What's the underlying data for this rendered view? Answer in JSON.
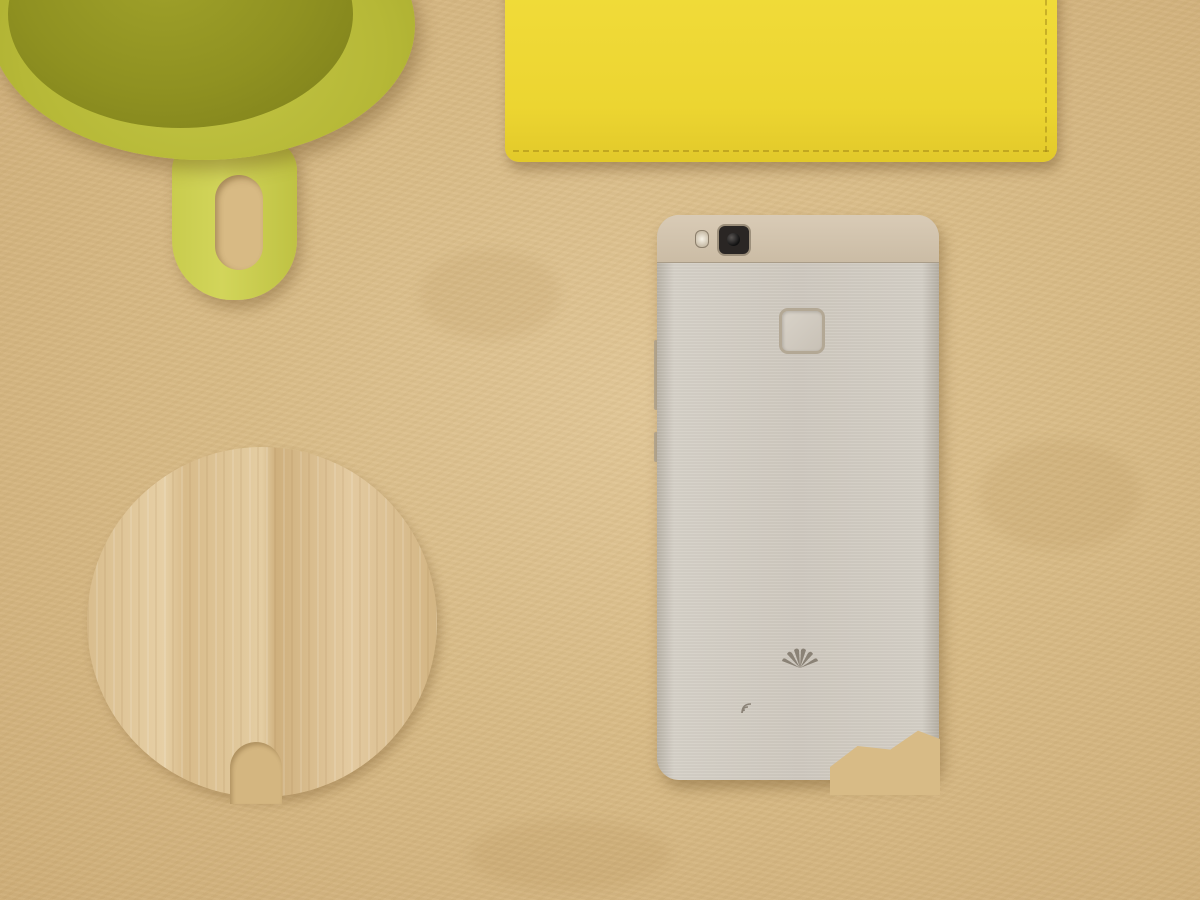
{
  "scene": {
    "background_color": "#d9bc87",
    "objects": {
      "mug": {
        "icon": "mug-icon",
        "color": "#b6b837"
      },
      "notebook": {
        "icon": "notebook-icon",
        "color": "#ecd531"
      },
      "coaster": {
        "icon": "coaster-icon",
        "color": "#e0c79b"
      },
      "phone": {
        "icon": "phone-icon",
        "color": "#cfc9bf",
        "camera": "camera-icon",
        "flash": "flash-icon",
        "fingerprint_sensor": "fingerprint-icon",
        "brand_logo": "logo-icon",
        "nfc_mark": "nfc-icon"
      }
    }
  }
}
